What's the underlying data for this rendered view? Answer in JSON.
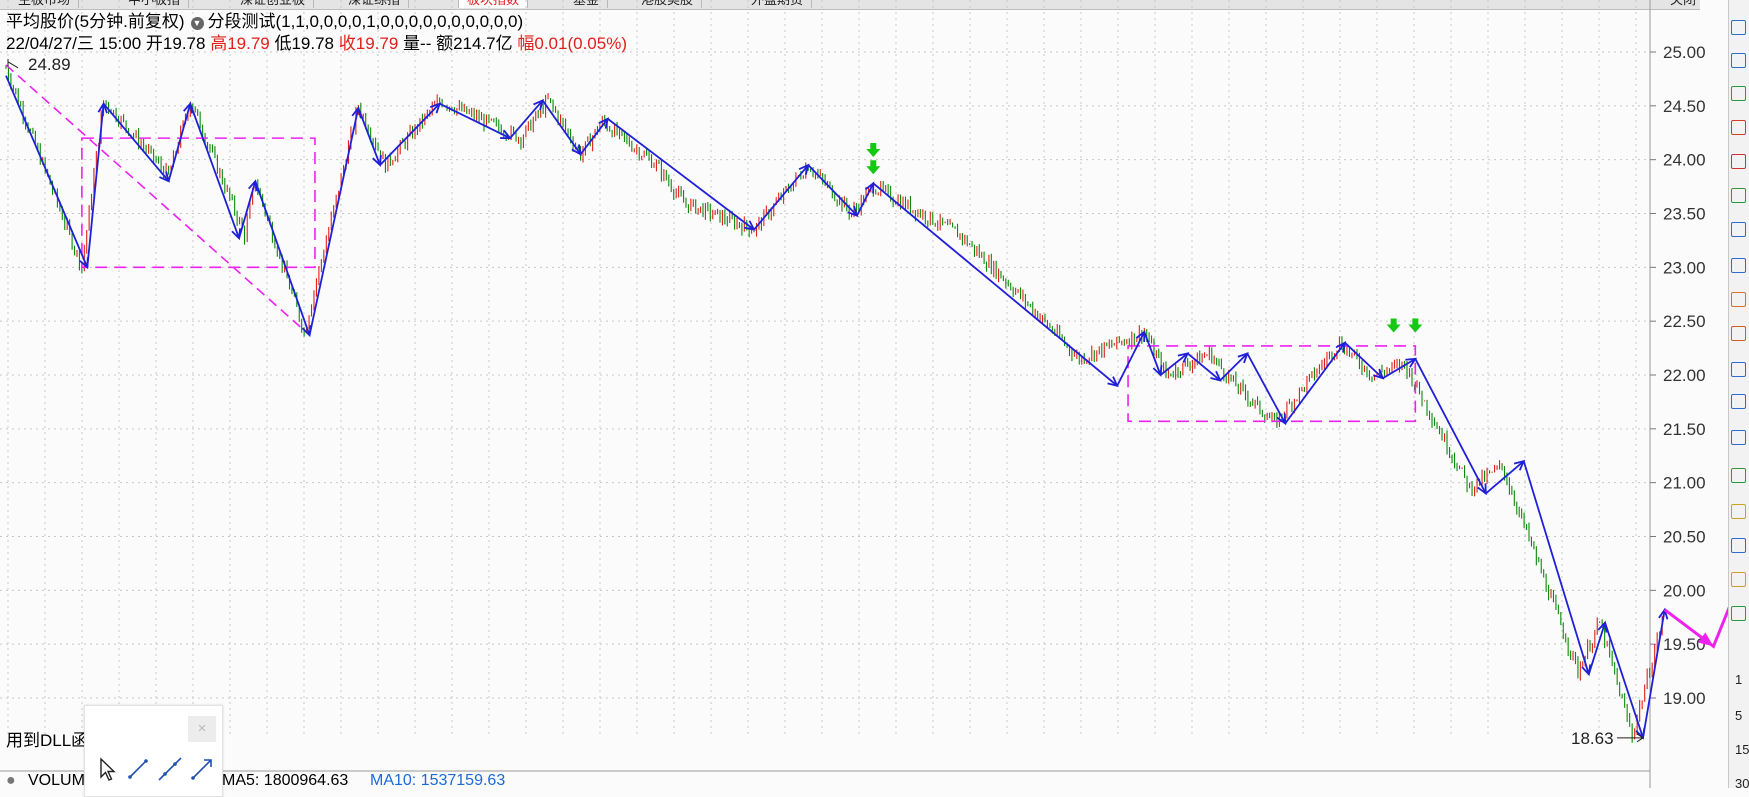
{
  "tabs": [
    {
      "label": "主板市场",
      "active": false
    },
    {
      "label": "中小板指",
      "active": false
    },
    {
      "label": "深证创业板",
      "active": false
    },
    {
      "label": "深证综指",
      "active": false
    },
    {
      "label": "板块指数",
      "active": true
    },
    {
      "label": "基金",
      "active": false
    },
    {
      "label": "港股美股",
      "active": false
    },
    {
      "label": "外盘期货",
      "active": false
    }
  ],
  "top_right": "关闭",
  "header": {
    "indicator": "平均股价(5分钟.前复权)",
    "formula": "分段测试(1,1,0,0,0,0,1,0,0,0,0,0,0,0,0,0,0)",
    "datetime": "22/04/27/三 15:00",
    "open_label": "开",
    "open": "19.78",
    "high_label": "高",
    "high": "19.79",
    "low_label": "低",
    "low": "19.78",
    "close_label": "收",
    "close": "19.79",
    "vol_label": "量--",
    "amount_label": "额",
    "amount": "214.7亿",
    "change_label": "幅",
    "change": "0.01(0.05%)"
  },
  "dll_label": "用到DLL函",
  "volume_bar": {
    "label": "VOLUM",
    "ma5": "MA5: 1800964.63",
    "ma10": "MA10: 1537159.63"
  },
  "side_labels": [
    "1",
    "5",
    "15",
    "30"
  ],
  "colors": {
    "up": "#e0201a",
    "down": "#0a8a0a",
    "zigzag": "#2020d8",
    "box": "#ee22ee",
    "marker": "#16c816",
    "grid": "#c8c8c8"
  },
  "chart_data": {
    "type": "line",
    "ylim": [
      18.45,
      25.35
    ],
    "yticks": [
      19.0,
      19.5,
      20.0,
      20.5,
      21.0,
      21.5,
      22.0,
      22.5,
      23.0,
      23.5,
      24.0,
      24.5,
      25.0
    ],
    "ytick_labels": [
      "19.00",
      "19.50",
      "20.00",
      "20.50",
      "21.00",
      "21.50",
      "22.00",
      "22.50",
      "23.00",
      "23.50",
      "24.00",
      "24.50",
      "25.00"
    ],
    "n_bars": 300,
    "price_path": [
      [
        0,
        24.85
      ],
      [
        14,
        23.0
      ],
      [
        18,
        24.55
      ],
      [
        30,
        23.85
      ],
      [
        34,
        24.55
      ],
      [
        44,
        23.3
      ],
      [
        46,
        23.8
      ],
      [
        55,
        22.4
      ],
      [
        65,
        24.5
      ],
      [
        70,
        23.95
      ],
      [
        80,
        24.55
      ],
      [
        95,
        24.2
      ],
      [
        100,
        24.55
      ],
      [
        106,
        24.05
      ],
      [
        110,
        24.35
      ],
      [
        120,
        23.95
      ],
      [
        125,
        23.6
      ],
      [
        138,
        23.35
      ],
      [
        148,
        23.95
      ],
      [
        156,
        23.5
      ],
      [
        160,
        23.75
      ],
      [
        176,
        23.3
      ],
      [
        184,
        22.9
      ],
      [
        198,
        22.15
      ],
      [
        210,
        22.4
      ],
      [
        214,
        22.0
      ],
      [
        222,
        22.2
      ],
      [
        226,
        21.95
      ],
      [
        234,
        21.55
      ],
      [
        246,
        22.3
      ],
      [
        252,
        22.0
      ],
      [
        258,
        22.1
      ],
      [
        270,
        20.95
      ],
      [
        276,
        21.15
      ],
      [
        290,
        19.25
      ],
      [
        294,
        19.7
      ],
      [
        300,
        18.65
      ],
      [
        306,
        19.8
      ]
    ],
    "zigzag": [
      [
        0,
        24.78
      ],
      [
        15,
        23.0
      ],
      [
        18,
        24.52
      ],
      [
        30,
        23.8
      ],
      [
        34,
        24.52
      ],
      [
        43,
        23.27
      ],
      [
        46,
        23.8
      ],
      [
        56,
        22.37
      ],
      [
        65,
        24.48
      ],
      [
        69,
        23.95
      ],
      [
        80,
        24.52
      ],
      [
        93,
        24.2
      ],
      [
        99,
        24.55
      ],
      [
        106,
        24.05
      ],
      [
        111,
        24.38
      ],
      [
        138,
        23.35
      ],
      [
        148,
        23.95
      ],
      [
        157,
        23.48
      ],
      [
        160,
        23.78
      ],
      [
        205,
        21.9
      ],
      [
        210,
        22.4
      ],
      [
        213,
        22.0
      ],
      [
        218,
        22.2
      ],
      [
        224,
        21.95
      ],
      [
        229,
        22.2
      ],
      [
        236,
        21.55
      ],
      [
        247,
        22.3
      ],
      [
        254,
        21.97
      ],
      [
        260,
        22.15
      ],
      [
        273,
        20.9
      ],
      [
        280,
        21.2
      ],
      [
        292,
        19.22
      ],
      [
        295,
        19.7
      ],
      [
        302,
        18.63
      ],
      [
        306,
        19.82
      ]
    ],
    "channel_line": [
      [
        0,
        24.88
      ],
      [
        56,
        22.37
      ]
    ],
    "channel_line2": [
      [
        160,
        23.78
      ],
      [
        205,
        21.9
      ]
    ],
    "boxes": [
      {
        "x0": 14,
        "x1": 57,
        "y0": 23.0,
        "y1": 24.2
      },
      {
        "x0": 207,
        "x1": 260,
        "y0": 21.57,
        "y1": 22.27
      }
    ],
    "forecast": [
      [
        306,
        19.82
      ],
      [
        315,
        19.48
      ],
      [
        322,
        20.35
      ]
    ],
    "markers": [
      {
        "x": 160,
        "y": 24.08
      },
      {
        "x": 160,
        "y": 23.92
      },
      {
        "x": 256,
        "y": 22.45
      },
      {
        "x": 260,
        "y": 22.45
      }
    ],
    "high_label": {
      "x": 0,
      "y": 24.89,
      "text": "24.89"
    },
    "low_label": {
      "x": 302,
      "y": 18.63,
      "text": "18.63"
    }
  }
}
